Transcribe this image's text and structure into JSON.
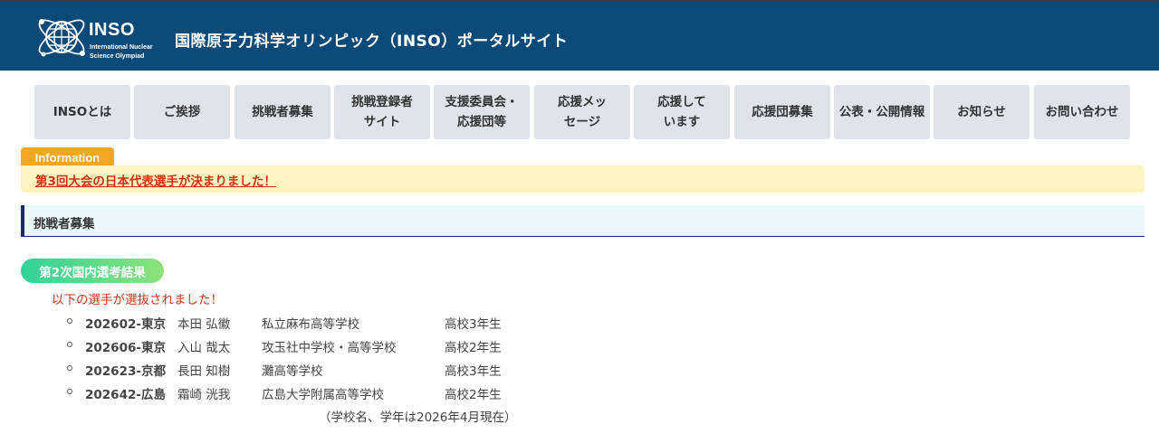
{
  "header": {
    "logo_text": "INSO",
    "logo_sub_line1": "International Nuclear",
    "logo_sub_line2": "Science Olympiad",
    "site_title": "国際原子力科学オリンピック（INSO）ポータルサイト",
    "colors": {
      "header_bg": "#0b4a78"
    }
  },
  "nav": {
    "items": [
      {
        "label": "INSOとは"
      },
      {
        "label": "ご挨拶"
      },
      {
        "label": "挑戦者募集"
      },
      {
        "label": "挑戦登録者\nサイト"
      },
      {
        "label": "支援委員会・\n応援団等"
      },
      {
        "label": "応援メッ\nセージ"
      },
      {
        "label": "応援して\nいます"
      },
      {
        "label": "応援団募集"
      },
      {
        "label": "公表・公開情報"
      },
      {
        "label": "お知らせ"
      },
      {
        "label": "お問い合わせ"
      }
    ]
  },
  "info": {
    "tab_label": "Information",
    "link_text": "第3回大会の日本代表選手が決まりました！",
    "colors": {
      "tab": "#f5a623",
      "bar": "#fdf5c0",
      "link": "#d2330f"
    }
  },
  "section": {
    "title": "挑戦者募集"
  },
  "results": {
    "pill_label": "第2次国内選考結果",
    "announcement": "以下の選手が選抜されました！",
    "rows": [
      {
        "id": "202602-東京",
        "name": "本田 弘徽",
        "school": "私立麻布高等学校",
        "grade": "高校3年生"
      },
      {
        "id": "202606-東京",
        "name": "入山 哉太",
        "school": "攻玉社中学校・高等学校",
        "grade": "高校2年生"
      },
      {
        "id": "202623-京都",
        "name": "長田 知樹",
        "school": "灘高等学校",
        "grade": "高校3年生"
      },
      {
        "id": "202642-広島",
        "name": "霜崎 洸我",
        "school": "広島大学附属高等学校",
        "grade": "高校2年生"
      }
    ],
    "note": "（学校名、学年は2026年4月現在）"
  }
}
